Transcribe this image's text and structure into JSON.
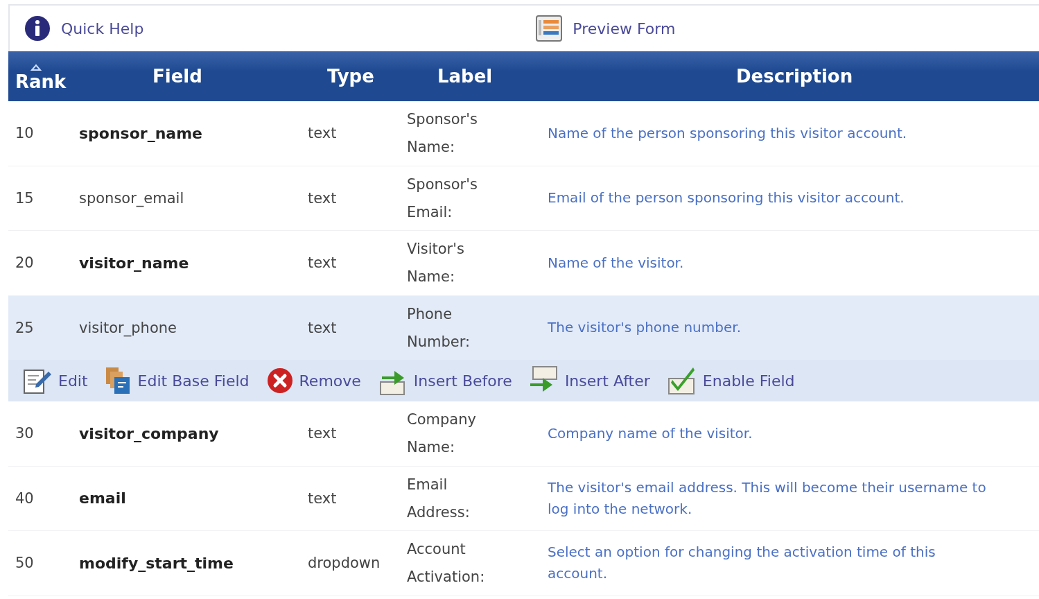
{
  "toolbar": {
    "help": "Quick Help",
    "preview": "Preview Form"
  },
  "table": {
    "columns": [
      {
        "label": "Rank",
        "sorted": true
      },
      {
        "label": "Field",
        "sorted": false
      },
      {
        "label": "Type",
        "sorted": false
      },
      {
        "label": "Label",
        "sorted": false
      },
      {
        "label": "Description",
        "sorted": false
      }
    ],
    "rows": [
      {
        "rank": "10",
        "field": "sponsor_name",
        "bold": true,
        "type": "text",
        "label": [
          "Sponsor's",
          "Name:"
        ],
        "description": [
          "Name of the person sponsoring this visitor account."
        ],
        "selected": false
      },
      {
        "rank": "15",
        "field": "sponsor_email",
        "bold": false,
        "type": "text",
        "label": [
          "Sponsor's",
          "Email:"
        ],
        "description": [
          "Email of the person sponsoring this visitor account."
        ],
        "selected": false
      },
      {
        "rank": "20",
        "field": "visitor_name",
        "bold": true,
        "type": "text",
        "label": [
          "Visitor's",
          "Name:"
        ],
        "description": [
          "Name of the visitor."
        ],
        "selected": false
      },
      {
        "rank": "25",
        "field": "visitor_phone",
        "bold": false,
        "type": "text",
        "label": [
          "Phone",
          "Number:"
        ],
        "description": [
          "The visitor's phone number."
        ],
        "selected": true
      },
      {
        "rank": "30",
        "field": "visitor_company",
        "bold": true,
        "type": "text",
        "label": [
          "Company",
          "Name:"
        ],
        "description": [
          "Company name of the visitor."
        ],
        "selected": false
      },
      {
        "rank": "40",
        "field": "email",
        "bold": true,
        "type": "text",
        "label": [
          "Email",
          "Address:"
        ],
        "description": [
          "The visitor's email address. This will become their username to",
          "log into the network."
        ],
        "selected": false
      },
      {
        "rank": "50",
        "field": "modify_start_time",
        "bold": true,
        "type": "dropdown",
        "label": [
          "Account",
          "Activation:"
        ],
        "description": [
          "Select an option for changing the activation time of this",
          "account."
        ],
        "selected": false
      }
    ],
    "row_actions": [
      {
        "kind": "edit",
        "label": "Edit"
      },
      {
        "kind": "base",
        "label": "Edit Base Field"
      },
      {
        "kind": "remove",
        "label": "Remove"
      },
      {
        "kind": "before",
        "label": "Insert Before"
      },
      {
        "kind": "after",
        "label": "Insert After"
      },
      {
        "kind": "enable",
        "label": "Enable Field"
      }
    ]
  }
}
